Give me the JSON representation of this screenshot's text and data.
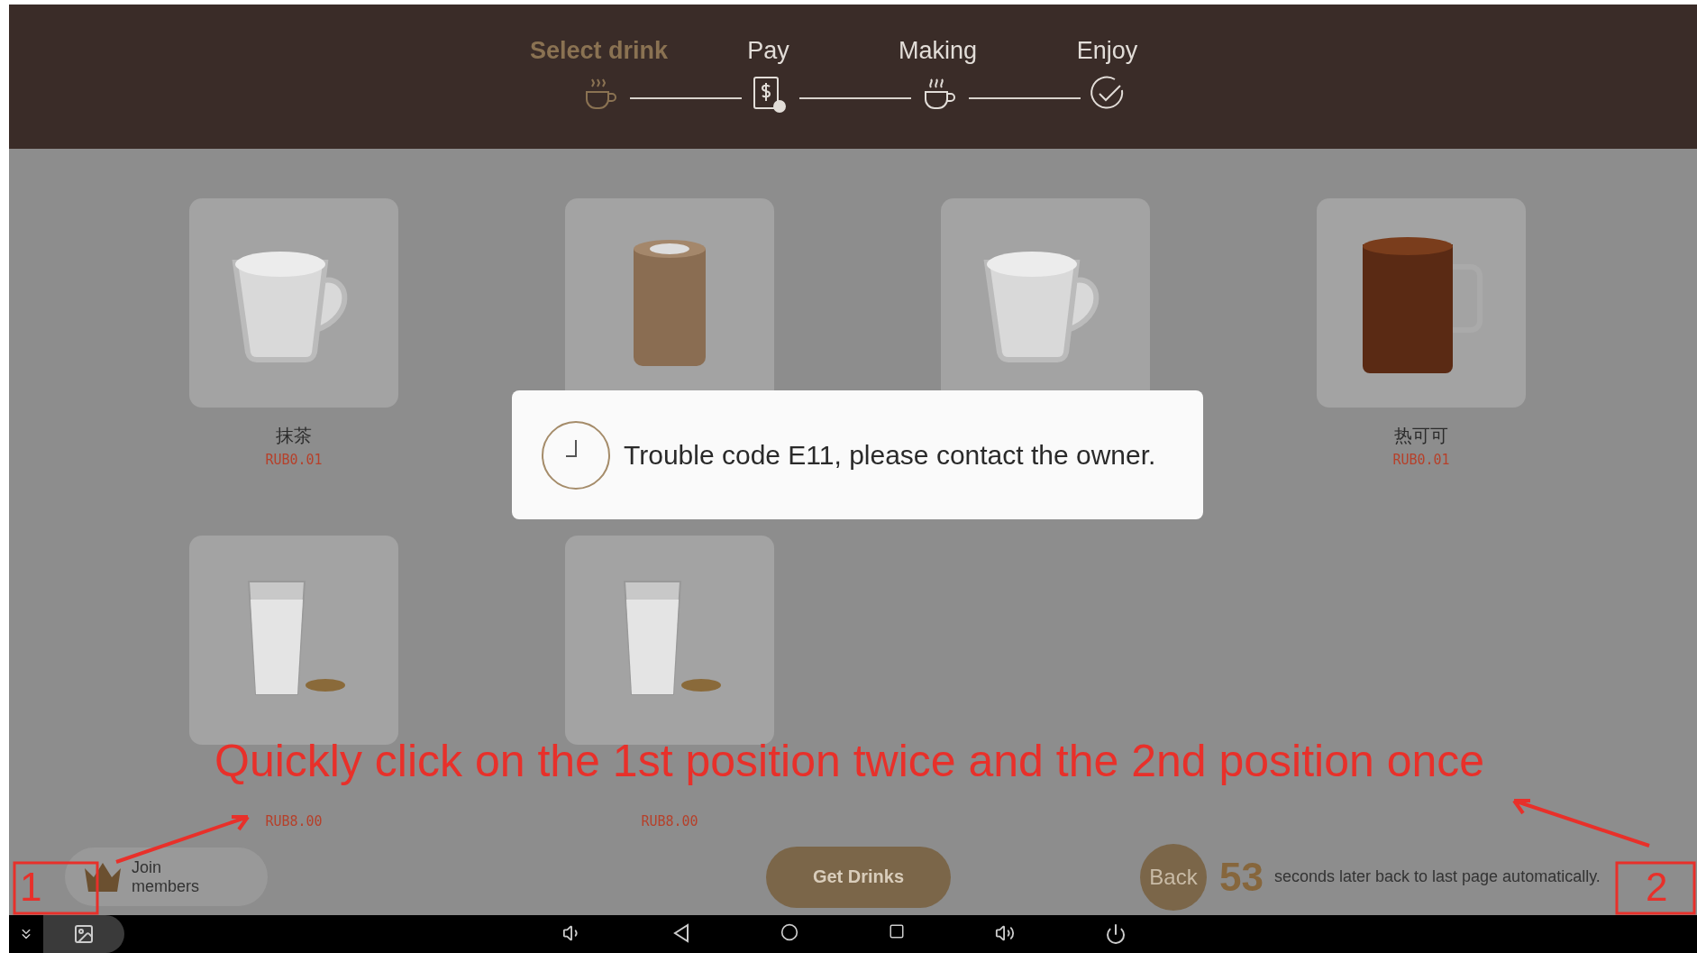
{
  "steps": [
    {
      "label": "Select drink",
      "kind": "cup",
      "selected": true
    },
    {
      "label": "Pay",
      "kind": "bill",
      "selected": false
    },
    {
      "label": "Making",
      "kind": "steam",
      "selected": false
    },
    {
      "label": "Enjoy",
      "kind": "check",
      "selected": false
    }
  ],
  "drinks": [
    {
      "name": "抹茶",
      "price": "RUB0.01",
      "kind": "mug"
    },
    {
      "kind": "tall"
    },
    {
      "kind": "mug"
    },
    {
      "name": "热可可",
      "price": "RUB0.01",
      "kind": "cocoa"
    },
    {
      "price": "RUB8.00",
      "kind": "glass"
    },
    {
      "price": "RUB8.00",
      "kind": "glass"
    }
  ],
  "dialog": {
    "message": "Trouble code E11, please contact the owner."
  },
  "footer": {
    "join": "Join\nmembers",
    "get_drinks": "Get Drinks",
    "back": "Back",
    "countdown": "53",
    "countdown_text": "seconds later back to last page automatically."
  },
  "annotation": {
    "instruction": "Quickly click on the 1st position twice and the 2nd position once",
    "markers": [
      "1",
      "2"
    ]
  }
}
